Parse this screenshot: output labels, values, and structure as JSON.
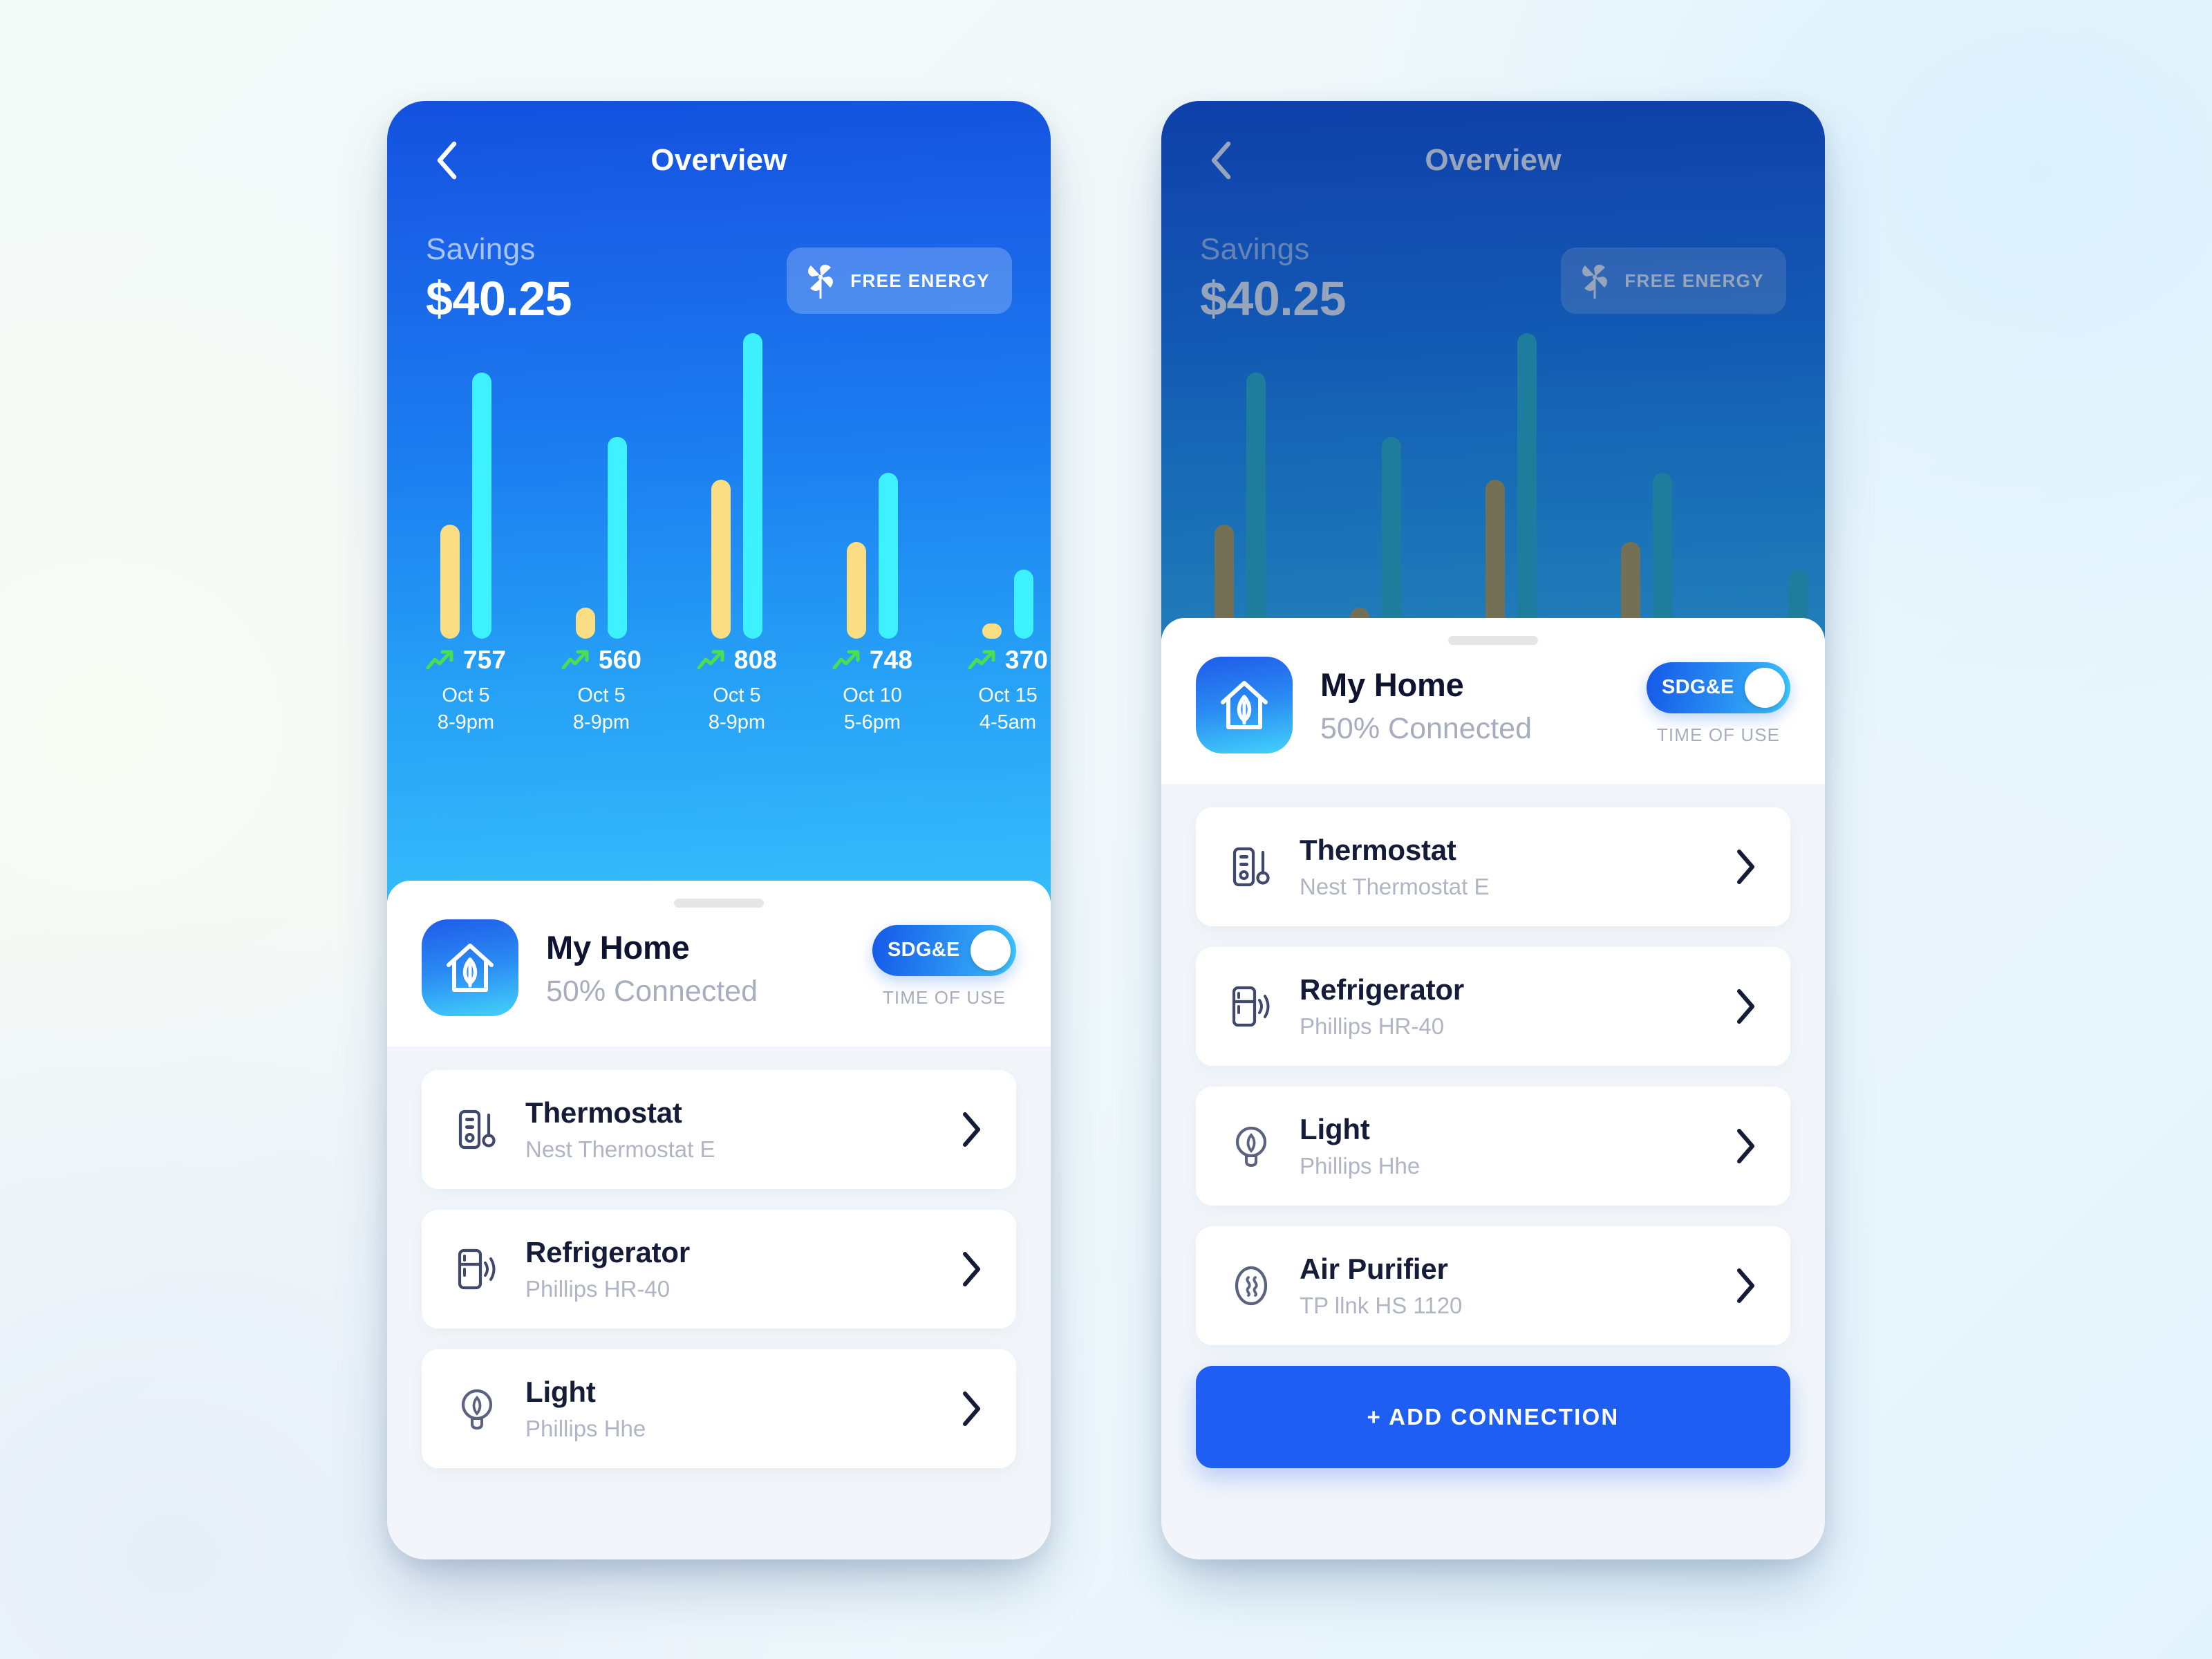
{
  "header": {
    "back_icon": "chevron-left-icon",
    "title": "Overview",
    "savings_label": "Savings",
    "savings_amount": "$40.25",
    "free_energy_label": "FREE ENERGY",
    "free_energy_icon": "pinwheel-icon"
  },
  "chart_data": {
    "type": "bar",
    "title": "Savings",
    "xlabel": "",
    "ylabel": "",
    "ylim": [
      0,
      900
    ],
    "grid": false,
    "legend": "none",
    "categories": [
      "Oct 5 8-9pm",
      "Oct 5 8-9pm",
      "Oct 5 8-9pm",
      "Oct 10 5-6pm",
      "Oct 15 4-5am"
    ],
    "dates": [
      "Oct 5",
      "Oct 5",
      "Oct 5",
      "Oct 10",
      "Oct 15"
    ],
    "times": [
      "8-9pm",
      "8-9pm",
      "8-9pm",
      "5-6pm",
      "4-5am"
    ],
    "value_labels": [
      "757",
      "560",
      "808",
      "748",
      "370"
    ],
    "trend_icon": "trend-up-arrow-icon",
    "series": [
      {
        "name": "usage-yellow",
        "color": "#fbde84",
        "values": [
          165,
          45,
          230,
          140,
          22
        ]
      },
      {
        "name": "savings-cyan",
        "color": "#3ef1ff",
        "values": [
          385,
          292,
          442,
          240,
          100
        ]
      }
    ]
  },
  "home_card": {
    "icon": "home-leaf-icon",
    "title": "My Home",
    "subtitle": "50% Connected",
    "toggle_label": "SDG&E",
    "toggle_caption": "TIME OF USE",
    "toggle_state": "on"
  },
  "devices_left": [
    {
      "icon": "thermostat-icon",
      "name": "Thermostat",
      "model": "Nest Thermostat E",
      "chevron": "chevron-right-icon"
    },
    {
      "icon": "refrigerator-icon",
      "name": "Refrigerator",
      "model": "Phillips HR-40",
      "chevron": "chevron-right-icon"
    },
    {
      "icon": "lightbulb-icon",
      "name": "Light",
      "model": "Phillips Hhe",
      "chevron": "chevron-right-icon"
    }
  ],
  "devices_right": [
    {
      "icon": "thermostat-icon",
      "name": "Thermostat",
      "model": "Nest Thermostat E",
      "chevron": "chevron-right-icon"
    },
    {
      "icon": "refrigerator-icon",
      "name": "Refrigerator",
      "model": "Phillips HR-40",
      "chevron": "chevron-right-icon"
    },
    {
      "icon": "lightbulb-icon",
      "name": "Light",
      "model": "Phillips Hhe",
      "chevron": "chevron-right-icon"
    },
    {
      "icon": "air-purifier-icon",
      "name": "Air Purifier",
      "model": "TP llnk HS 1120",
      "chevron": "chevron-right-icon"
    }
  ],
  "add_connection_label": "+ ADD CONNECTION",
  "colors": {
    "accent_blue": "#1f5ef2",
    "bar_yellow": "#fbde84",
    "bar_cyan": "#3ef1ff",
    "trend_green": "#4ade50",
    "text_dark": "#141c38",
    "text_muted": "#b0b5c4"
  }
}
